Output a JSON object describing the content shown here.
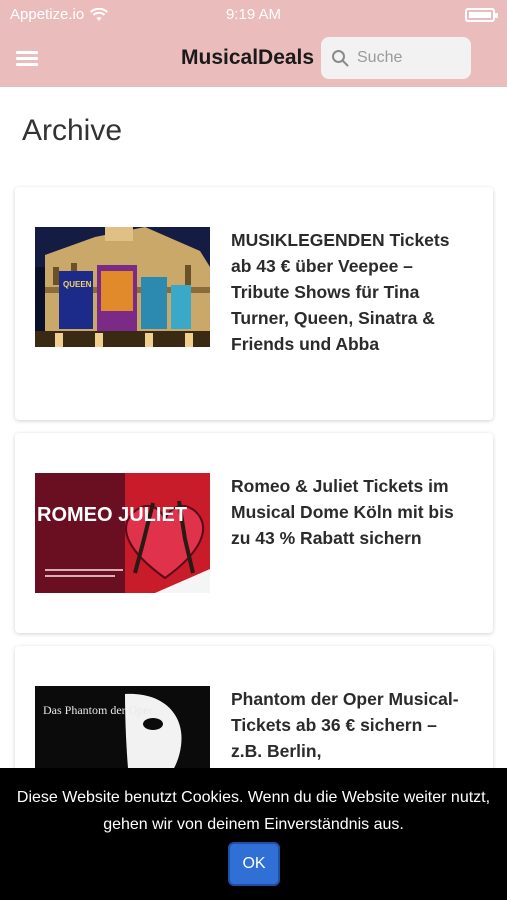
{
  "status_bar": {
    "carrier": "Appetize.io",
    "time": "9:19 AM"
  },
  "navbar": {
    "brand": "MusicalDeals",
    "search_placeholder": "Suche"
  },
  "page": {
    "title": "Archive"
  },
  "articles": [
    {
      "title": "MUSIKLEGENDEN Tickets ab 43 € über Veepee – Tribute Shows für Tina Turner, Queen, Sinatra & Friends und Abba",
      "image_text": "QUEEN"
    },
    {
      "title": "Romeo & Juliet Tickets im Musical Dome Köln mit bis zu 43 % Rabatt sichern",
      "image_text": "ROMEO JULIET"
    },
    {
      "title": "Phantom der Oper Musical-Tickets ab 36 € sichern – z.B. Berlin,",
      "image_text": "Das Phantom der Oper"
    }
  ],
  "cookie_banner": {
    "text": "Diese Website benutzt Cookies. Wenn du die Website weiter nutzt, gehen wir von deinem Einverständnis aus.",
    "ok_label": "OK"
  },
  "colors": {
    "header": "#ebbcbc",
    "cookie_bg": "#000000",
    "ok_button": "#2f6fd6"
  }
}
